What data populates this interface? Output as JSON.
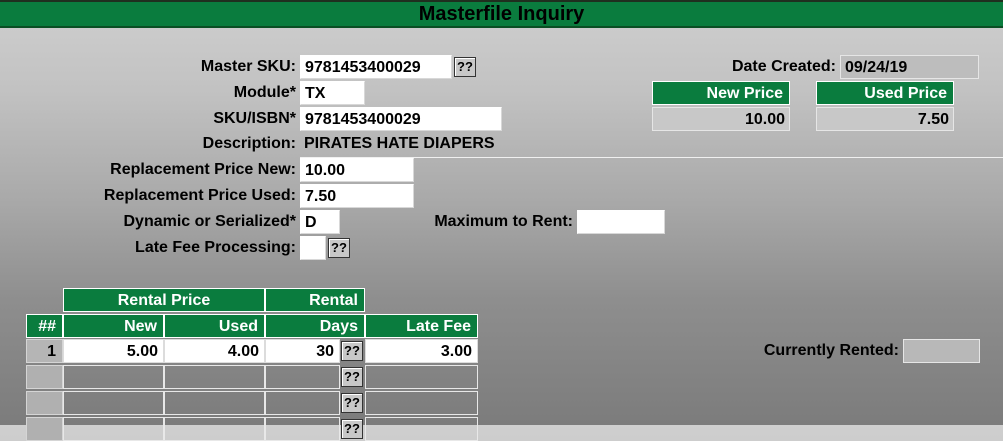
{
  "window": {
    "title": "Masterfile Inquiry"
  },
  "form": {
    "master_sku_label": "Master SKU:",
    "master_sku_value": "9781453400029",
    "module_label": "Module*",
    "module_value": "TX",
    "sku_isbn_label": "SKU/ISBN*",
    "sku_isbn_value": "9781453400029",
    "description_label": "Description:",
    "description_value": "PIRATES HATE DIAPERS",
    "replacement_new_label": "Replacement Price New:",
    "replacement_new_value": "10.00",
    "replacement_used_label": "Replacement Price Used:",
    "replacement_used_value": "7.50",
    "dynamic_label": "Dynamic or Serialized*",
    "dynamic_value": "D",
    "max_rent_label": "Maximum to Rent:",
    "max_rent_value": "",
    "late_fee_processing_label": "Late Fee Processing:",
    "late_fee_processing_value": "",
    "lookup_button": "??"
  },
  "info": {
    "date_created_label": "Date Created:",
    "date_created_value": "09/24/19",
    "new_price_header": "New Price",
    "used_price_header": "Used Price",
    "new_price_value": "10.00",
    "used_price_value": "7.50",
    "currently_rented_label": "Currently Rented:",
    "currently_rented_value": ""
  },
  "grid": {
    "group_headers": {
      "rental_price": "Rental Price",
      "rental": "Rental"
    },
    "columns": {
      "row_no": "##",
      "new": "New",
      "used": "Used",
      "days": "Days",
      "late_fee": "Late Fee"
    },
    "rows": [
      {
        "row_no": "1",
        "new": "5.00",
        "used": "4.00",
        "days": "30",
        "late_fee": "3.00"
      },
      {
        "row_no": "",
        "new": "",
        "used": "",
        "days": "",
        "late_fee": ""
      },
      {
        "row_no": "",
        "new": "",
        "used": "",
        "days": "",
        "late_fee": ""
      },
      {
        "row_no": "",
        "new": "",
        "used": "",
        "days": "",
        "late_fee": ""
      }
    ]
  }
}
